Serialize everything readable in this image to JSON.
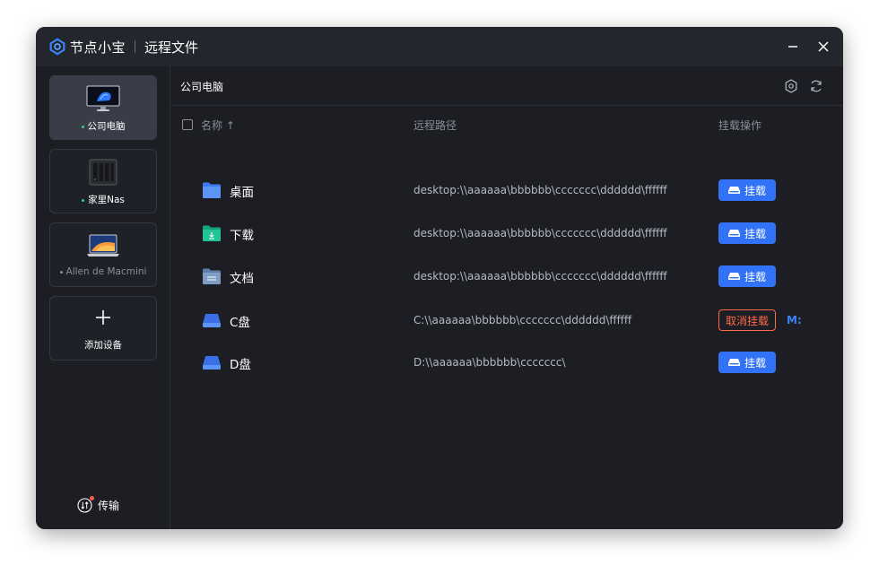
{
  "app": {
    "brand": "节点小宝",
    "page_title": "远程文件"
  },
  "sidebar": {
    "devices": [
      {
        "name": "公司电脑",
        "status": "online",
        "thumb": "pc-monitor-icon"
      },
      {
        "name": "家里Nas",
        "status": "online",
        "thumb": "nas-icon"
      },
      {
        "name": "Allen de Macmini",
        "status": "offline",
        "thumb": "laptop-icon"
      }
    ],
    "add_label": "添加设备",
    "transfer_label": "传输"
  },
  "main": {
    "title": "公司电脑",
    "columns": {
      "name": "名称 ↑",
      "path": "远程路径",
      "action": "挂载操作"
    },
    "rows": [
      {
        "name": "桌面",
        "icon": "folder-icon",
        "path": "desktop:\\\\aaaaaa\\bbbbbb\\ccccccc\\dddddd\\ffffff",
        "action": "挂载"
      },
      {
        "name": "下载",
        "icon": "download-folder-icon",
        "path": "desktop:\\\\aaaaaa\\bbbbbb\\ccccccc\\dddddd\\ffffff",
        "action": "挂载"
      },
      {
        "name": "文档",
        "icon": "document-folder-icon",
        "path": "desktop:\\\\aaaaaa\\bbbbbb\\ccccccc\\dddddd\\ffffff",
        "action": "挂载"
      },
      {
        "name": "C盘",
        "icon": "drive-icon",
        "path": "C:\\\\aaaaaa\\bbbbbb\\ccccccc\\dddddd\\ffffff",
        "action": "取消挂载",
        "drive_letter": "M:"
      },
      {
        "name": "D盘",
        "icon": "drive-icon",
        "path": "D:\\\\aaaaaa\\bbbbbb\\ccccccc\\",
        "action": "挂载"
      }
    ]
  },
  "colors": {
    "accent": "#3273f6",
    "danger": "#ff6a48",
    "online": "#2bd48a",
    "background": "#1c1e24"
  }
}
